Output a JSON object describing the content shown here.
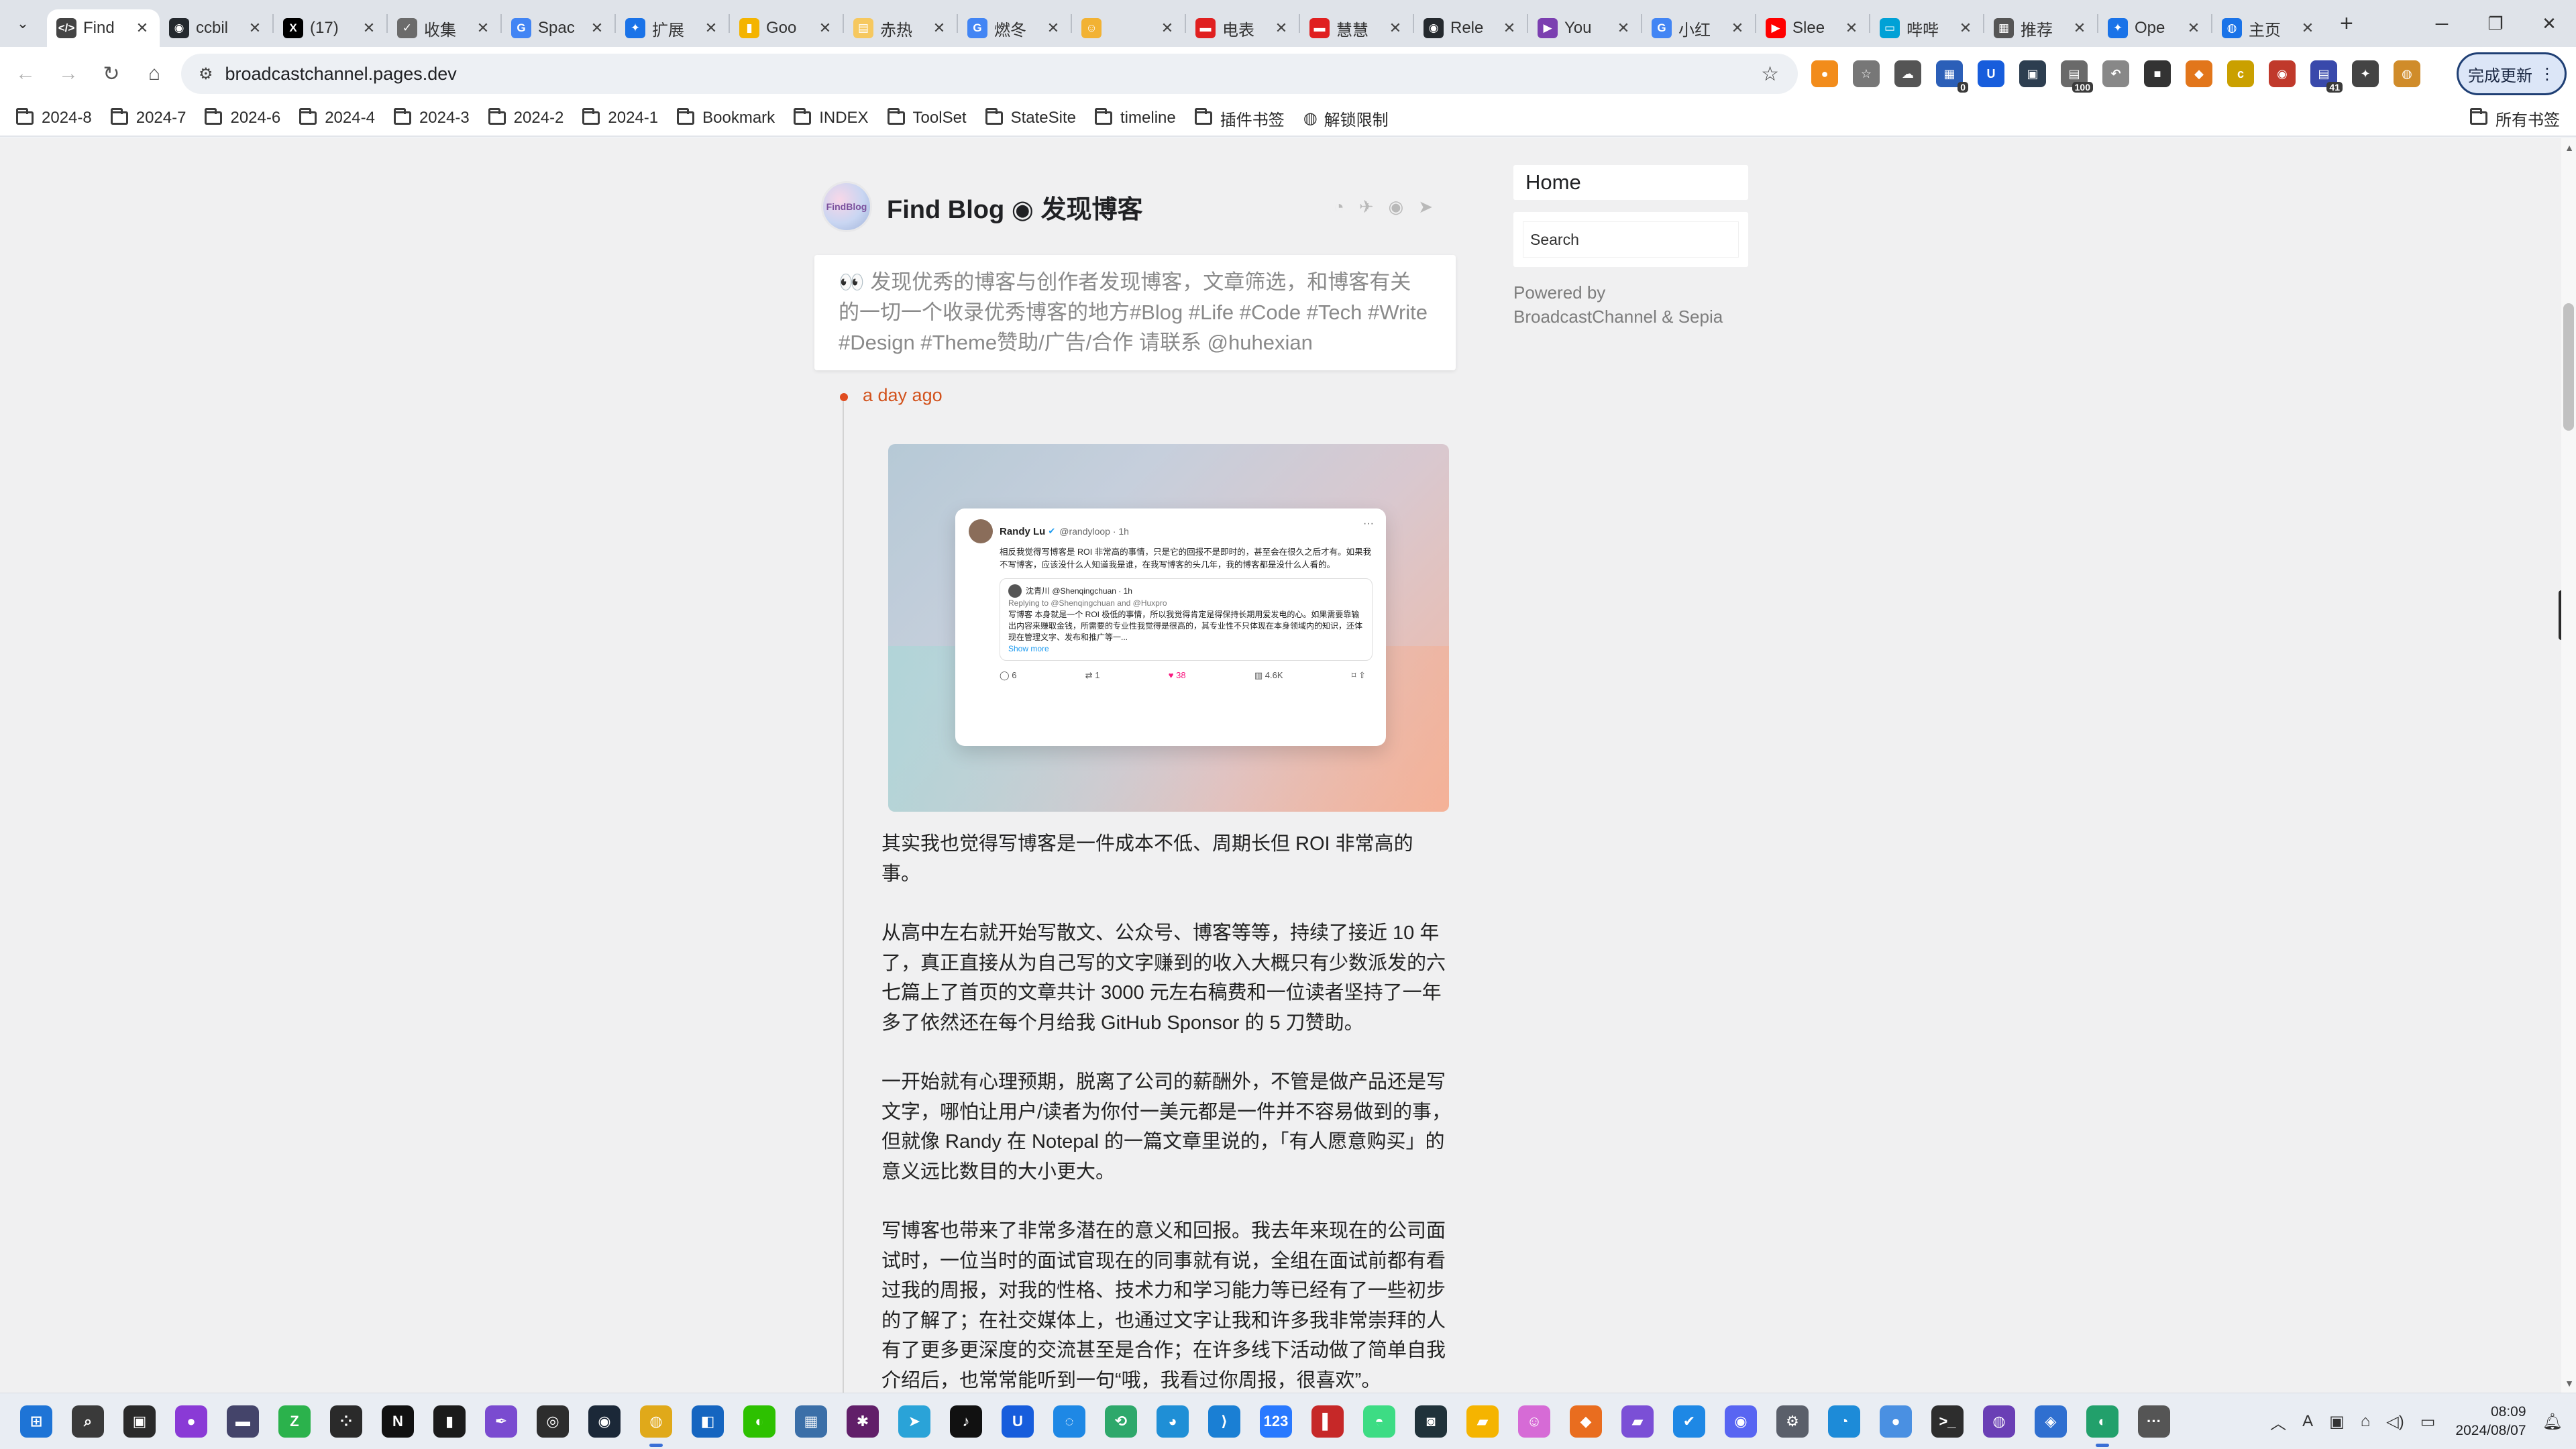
{
  "browser": {
    "tabs": [
      {
        "title": "Find",
        "favicon": "code-icon",
        "color": "#444444",
        "glyph": "</>",
        "active": true
      },
      {
        "title": "ccbil",
        "favicon": "github-icon",
        "color": "#24292e",
        "glyph": "◉"
      },
      {
        "title": "(17)",
        "favicon": "x-icon",
        "color": "#000000",
        "glyph": "X"
      },
      {
        "title": "收集",
        "favicon": "check-icon",
        "color": "#6b6b6b",
        "glyph": "✓"
      },
      {
        "title": "Spac",
        "favicon": "google-icon",
        "color": "#4285f4",
        "glyph": "G"
      },
      {
        "title": "扩展",
        "favicon": "puzzle-icon",
        "color": "#1a73e8",
        "glyph": "✦"
      },
      {
        "title": "Goo",
        "favicon": "keep-icon",
        "color": "#f4b400",
        "glyph": "▮"
      },
      {
        "title": "赤热",
        "favicon": "doc-icon",
        "color": "#f6c85f",
        "glyph": "▤"
      },
      {
        "title": "燃冬",
        "favicon": "google-icon",
        "color": "#4285f4",
        "glyph": "G"
      },
      {
        "title": "",
        "favicon": "emoji-icon",
        "color": "#f2b233",
        "glyph": "☺"
      },
      {
        "title": "电表",
        "favicon": "app-icon",
        "color": "#e02020",
        "glyph": "▬"
      },
      {
        "title": "慧慧",
        "favicon": "app-icon",
        "color": "#e02020",
        "glyph": "▬"
      },
      {
        "title": "Rele",
        "favicon": "github-icon",
        "color": "#24292e",
        "glyph": "◉"
      },
      {
        "title": "You",
        "favicon": "video-icon",
        "color": "#7b3fb0",
        "glyph": "▶"
      },
      {
        "title": "小红",
        "favicon": "google-icon",
        "color": "#4285f4",
        "glyph": "G"
      },
      {
        "title": "Slee",
        "favicon": "youtube-icon",
        "color": "#ff0000",
        "glyph": "▶"
      },
      {
        "title": "哔哔",
        "favicon": "tv-icon",
        "color": "#00a1d6",
        "glyph": "▭"
      },
      {
        "title": "推荐",
        "favicon": "list-icon",
        "color": "#555555",
        "glyph": "▦"
      },
      {
        "title": "Ope",
        "favicon": "puzzle-icon",
        "color": "#1a73e8",
        "glyph": "✦"
      },
      {
        "title": "主页",
        "favicon": "globe-icon",
        "color": "#1a73e8",
        "glyph": "◍"
      }
    ],
    "url": "broadcastchannel.pages.dev",
    "update_button": "完成更新",
    "bookmarks": [
      "2024-8",
      "2024-7",
      "2024-6",
      "2024-4",
      "2024-3",
      "2024-2",
      "2024-1",
      "Bookmark",
      "INDEX",
      "ToolSet",
      "StateSite",
      "timeline",
      "插件书签",
      "解锁限制"
    ],
    "all_bookmarks": "所有书签",
    "extensions": [
      {
        "name": "orange-ext-icon",
        "color": "#f28c1b",
        "glyph": "●"
      },
      {
        "name": "star-ext-icon",
        "color": "#777777",
        "glyph": "☆"
      },
      {
        "name": "cloud-ext-icon",
        "color": "#555555",
        "glyph": "☁"
      },
      {
        "name": "cal-ext-icon",
        "color": "#2b5fb8",
        "glyph": "▦",
        "badge": "0"
      },
      {
        "name": "bitwarden-ext-icon",
        "color": "#175ddc",
        "glyph": "U"
      },
      {
        "name": "box-ext-icon",
        "color": "#2d3e50",
        "glyph": "▣"
      },
      {
        "name": "counter-ext-icon",
        "color": "#6a6a6a",
        "glyph": "▤",
        "badge": "100"
      },
      {
        "name": "back-ext-icon",
        "color": "#888888",
        "glyph": "↶"
      },
      {
        "name": "dark-ext-icon",
        "color": "#333333",
        "glyph": "■"
      },
      {
        "name": "fox-ext-icon",
        "color": "#e2761b",
        "glyph": "◆"
      },
      {
        "name": "c-ext-icon",
        "color": "#caa000",
        "glyph": "c"
      },
      {
        "name": "red-ext-icon",
        "color": "#c0392b",
        "glyph": "◉"
      },
      {
        "name": "blue-ext-icon",
        "color": "#3949ab",
        "glyph": "▤",
        "badge": "41"
      },
      {
        "name": "puzzle-ext-icon",
        "color": "#444444",
        "glyph": "✦"
      },
      {
        "name": "profile-ext-icon",
        "color": "#d08c2a",
        "glyph": "◍"
      }
    ]
  },
  "site": {
    "title": "Find Blog ◉ 发现博客",
    "intro": "👀 发现优秀的博客与创作者发现博客，文章筛选，和博客有关的一切一个收录优秀博客的地方#Blog #Life #Code #Tech #Write #Design #Theme赞助/广告/合作 请联系 @huhexian",
    "post_time": "a day ago",
    "tweet": {
      "name": "Randy Lu",
      "handle": "@randyloop · 1h",
      "text": "相反我觉得写博客是 ROI 非常高的事情，只是它的回报不是即时的，甚至会在很久之后才有。如果我不写博客，应该没什么人知道我是谁，在我写博客的头几年，我的博客都是没什么人看的。",
      "quote_name": "沈青川 @Shenqingchuan · 1h",
      "quote_reply": "Replying to @Shenqingchuan and @Huxpro",
      "quote_text": "写博客 本身就是一个 ROI 极低的事情，所以我觉得肯定是得保持长期用爱发电的心。如果需要靠输出内容来赚取金钱，所需要的专业性我觉得是很高的，其专业性不只体现在本身领域内的知识，还体现在管理文字、发布和推广等一...",
      "quote_more": "Show more",
      "replies": "6",
      "retweets": "1",
      "likes": "38",
      "views": "4.6K"
    },
    "paragraphs": [
      "其实我也觉得写博客是一件成本不低、周期长但 ROI 非常高的事。",
      "从高中左右就开始写散文、公众号、博客等等，持续了接近 10 年了，真正直接从为自己写的文字赚到的收入大概只有少数派发的六七篇上了首页的文章共计 3000 元左右稿费和一位读者坚持了一年多了依然还在每个月给我 GitHub Sponsor 的 5 刀赞助。",
      "一开始就有心理预期，脱离了公司的薪酬外，不管是做产品还是写文字，哪怕让用户/读者为你付一美元都是一件并不容易做到的事，但就像 Randy 在 Notepal 的一篇文章里说的，「有人愿意购买」的意义远比数目的大小更大。",
      "写博客也带来了非常多潜在的意义和回报。我去年来现在的公司面试时，一位当时的面试官现在的同事就有说，全组在面试前都有看过我的周报，对我的性格、技术力和学习能力等已经有了一些初步的了解了；在社交媒体上，也通过文字让我和许多我非常崇拜的人有了更多更深度的交流甚至是合作；在许多线下活动做了简单自我介绍后，也常常能听到一句“哦，我看过你周报，很喜欢”。"
    ],
    "sidebar": {
      "home": "Home",
      "search_placeholder": "Search",
      "powered": "Powered by BroadcastChannel & Sepia"
    }
  },
  "taskbar": {
    "time": "08:09",
    "date": "2024/08/07",
    "apps": [
      {
        "name": "start-icon",
        "color": "#1e74d6",
        "glyph": "⊞"
      },
      {
        "name": "search-icon",
        "color": "#3a3a3a",
        "glyph": "⌕"
      },
      {
        "name": "taskview-icon",
        "color": "#2a2a2a",
        "glyph": "▣"
      },
      {
        "name": "orb-icon",
        "color": "#8a3ad6",
        "glyph": "●"
      },
      {
        "name": "media-icon",
        "color": "#44446a",
        "glyph": "▬"
      },
      {
        "name": "zhihu-icon",
        "color": "#2bb24c",
        "glyph": "Z"
      },
      {
        "name": "dots-icon",
        "color": "#2a2a2a",
        "glyph": "⁘"
      },
      {
        "name": "notion-icon",
        "color": "#111111",
        "glyph": "N"
      },
      {
        "name": "note-icon",
        "color": "#1b1b1b",
        "glyph": "▮"
      },
      {
        "name": "quill-icon",
        "color": "#7a4bd0",
        "glyph": "✒"
      },
      {
        "name": "obs-icon",
        "color": "#2d2d2d",
        "glyph": "◎"
      },
      {
        "name": "steam-icon",
        "color": "#1b2838",
        "glyph": "◉"
      },
      {
        "name": "chrome-icon",
        "color": "#e0a91a",
        "glyph": "◍",
        "active": true
      },
      {
        "name": "tool-icon",
        "color": "#1565c0",
        "glyph": "◧"
      },
      {
        "name": "wechat-icon",
        "color": "#2dc100",
        "glyph": "◐"
      },
      {
        "name": "store-icon",
        "color": "#3b6fa8",
        "glyph": "▦"
      },
      {
        "name": "slack-icon",
        "color": "#611f69",
        "glyph": "✱"
      },
      {
        "name": "telegram-icon",
        "color": "#2aa3d8",
        "glyph": "➤"
      },
      {
        "name": "tiktok-icon",
        "color": "#111111",
        "glyph": "♪"
      },
      {
        "name": "bitwarden-icon",
        "color": "#175ddc",
        "glyph": "U"
      },
      {
        "name": "safari-icon",
        "color": "#1e88e5",
        "glyph": "◌"
      },
      {
        "name": "share-icon",
        "color": "#2ea86b",
        "glyph": "⟲"
      },
      {
        "name": "edge-icon",
        "color": "#1f8fd6",
        "glyph": "◕"
      },
      {
        "name": "vscode-icon",
        "color": "#1a7fd4",
        "glyph": "⟩"
      },
      {
        "name": "calc-icon",
        "color": "#2979ff",
        "glyph": "123"
      },
      {
        "name": "book-icon",
        "color": "#c62828",
        "glyph": "▌"
      },
      {
        "name": "android-icon",
        "color": "#3ddc84",
        "glyph": "◓"
      },
      {
        "name": "cat-icon",
        "color": "#20323a",
        "glyph": "◙"
      },
      {
        "name": "folder-icon",
        "color": "#f5b400",
        "glyph": "▰"
      },
      {
        "name": "face-icon",
        "color": "#d66bd6",
        "glyph": "☺"
      },
      {
        "name": "fox-icon",
        "color": "#e96d1f",
        "glyph": "◆"
      },
      {
        "name": "files-icon",
        "color": "#7b4fd6",
        "glyph": "▰"
      },
      {
        "name": "check-icon",
        "color": "#1e88e5",
        "glyph": "✔"
      },
      {
        "name": "discord-icon",
        "color": "#5865f2",
        "glyph": "◉"
      },
      {
        "name": "settings-icon",
        "color": "#5a5f6a",
        "glyph": "⚙"
      },
      {
        "name": "bluebird-icon",
        "color": "#1d8bd8",
        "glyph": "◔"
      },
      {
        "name": "balloon-icon",
        "color": "#4a90e2",
        "glyph": "●"
      },
      {
        "name": "terminal-icon",
        "color": "#2d2d2d",
        "glyph": ">_"
      },
      {
        "name": "ghost-icon",
        "color": "#6a3fb5",
        "glyph": "◍"
      },
      {
        "name": "shield-icon",
        "color": "#2f6fd0",
        "glyph": "◈"
      },
      {
        "name": "browser2-icon",
        "color": "#22a06b",
        "glyph": "◐",
        "active": true
      },
      {
        "name": "more-icon",
        "color": "#555555",
        "glyph": "···"
      }
    ]
  }
}
